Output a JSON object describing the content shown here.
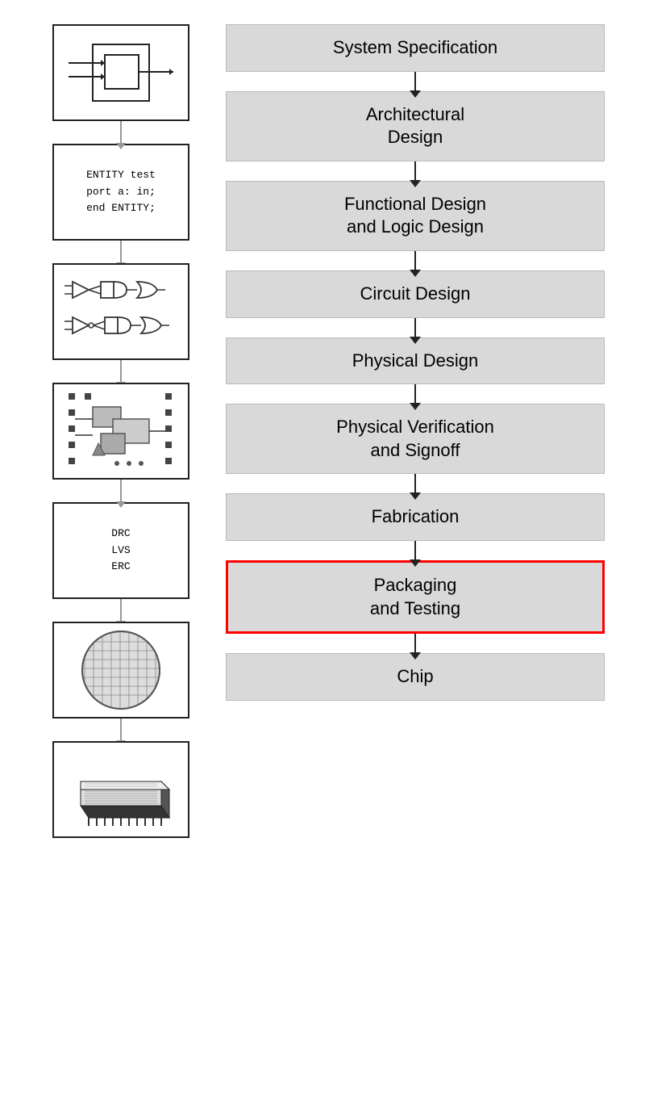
{
  "stages": [
    {
      "id": "system-spec",
      "label": "System\nSpecification",
      "highlighted": false
    },
    {
      "id": "architectural-design",
      "label": "Architectural\nDesign",
      "highlighted": false
    },
    {
      "id": "functional-design",
      "label": "Functional Design\nand Logic Design",
      "highlighted": false
    },
    {
      "id": "circuit-design",
      "label": "Circuit Design",
      "highlighted": false
    },
    {
      "id": "physical-design",
      "label": "Physical Design",
      "highlighted": false
    },
    {
      "id": "physical-verification",
      "label": "Physical Verification\nand Signoff",
      "highlighted": false
    },
    {
      "id": "fabrication",
      "label": "Fabrication",
      "highlighted": false
    },
    {
      "id": "packaging-testing",
      "label": "Packaging\nand Testing",
      "highlighted": true
    },
    {
      "id": "chip",
      "label": "Chip",
      "highlighted": false
    }
  ],
  "illustrations": [
    {
      "id": "block-diagram",
      "type": "block-diagram"
    },
    {
      "id": "entity-code",
      "type": "text",
      "content": "ENTITY test\nport a: in;\nend ENTITY;"
    },
    {
      "id": "logic-gates",
      "type": "logic-gates"
    },
    {
      "id": "layout",
      "type": "layout"
    },
    {
      "id": "drc-lvs",
      "type": "text",
      "content": "DRC\nLVS\nERC"
    },
    {
      "id": "wafer",
      "type": "wafer"
    },
    {
      "id": "chip-package",
      "type": "chip-package"
    }
  ]
}
